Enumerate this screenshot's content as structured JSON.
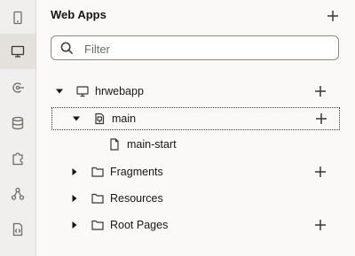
{
  "rail": {
    "items": [
      {
        "icon": "mobile-device-icon",
        "active": false
      },
      {
        "icon": "monitor-icon",
        "active": true
      },
      {
        "icon": "service-connection-icon",
        "active": false
      },
      {
        "icon": "database-icon",
        "active": false
      },
      {
        "icon": "puzzle-piece-icon",
        "active": false
      },
      {
        "icon": "process-icon",
        "active": false
      },
      {
        "icon": "source-file-icon",
        "active": false
      }
    ]
  },
  "panel": {
    "title": "Web Apps",
    "filter_placeholder": "Filter"
  },
  "tree": {
    "hrwebapp": "hrwebapp",
    "main": "main",
    "main_start": "main-start",
    "fragments": "Fragments",
    "resources": "Resources",
    "root_pages": "Root Pages"
  },
  "colors": {
    "background": "#fbf9f8",
    "rail_background": "#f1efed",
    "active_rail_item": "#e4e1dd",
    "text": "#161513"
  }
}
